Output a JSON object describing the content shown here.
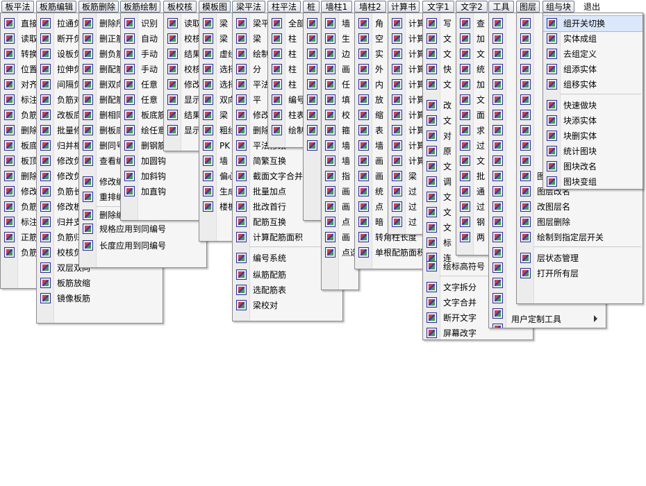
{
  "menubar": [
    "板平法",
    "板筋编辑",
    "板筋删除",
    "板筋绘制",
    "板校核",
    "模板图",
    "梁平法",
    "柱平法",
    "桩",
    "墙柱1",
    "墙柱2",
    "计算书",
    "文字1",
    "文字2",
    "工具",
    "图层",
    "组与块",
    "退出"
  ],
  "panels": {
    "p_banpingfa": [
      "直接",
      "读取",
      "转换",
      "位置",
      "对齐",
      "标注",
      "负筋",
      "删除",
      "板底",
      "板顶",
      "删除",
      "修改",
      "负筋",
      "标注",
      "正筋",
      "负筋"
    ],
    "p_banjin_edit": [
      "拉通负筋",
      "断开负筋",
      "设板负筋",
      "拉伸负筋",
      "间隔负筋",
      "负筋对齐",
      "改板底筋",
      "批量修改",
      "归并相同",
      "修改负筋",
      "修改负筋",
      "负筋长度",
      "修改板底",
      "归并支座",
      "负筋归并",
      "校核负筋长度",
      "双层双向",
      "板筋放缩",
      "镜像板筋"
    ],
    "p_banjin_del": [
      "删除所有",
      "删正筋",
      "删负筋",
      "删配筋",
      "删双向",
      "删配筋",
      "删相同",
      "删板底",
      "删同号",
      "查看编号",
      "修改编号",
      "重排编号",
      "删除编号",
      "规格应用到同编号",
      "长度应用到同编号"
    ],
    "p_banjin_draw": [
      "识别",
      "自动",
      "手动",
      "手动",
      "任意",
      "任意",
      "板底筋",
      "绘任意",
      "删钢筋钩子",
      "加圆钩",
      "加斜钩",
      "加直钩"
    ],
    "p_banjiaohe": [
      "读取",
      "校核",
      "结果",
      "校核",
      "修改",
      "显示",
      "结果",
      "显示"
    ],
    "p_mobantu": [
      "梁",
      "梁",
      "虚线",
      "选择",
      "选择",
      "双向",
      "梁",
      "粗线",
      "PK",
      "墙",
      "偏心",
      "生成",
      "楼板"
    ],
    "p_liangpingfa": [
      "梁平",
      "梁",
      "绘制",
      "分",
      "平法",
      "平",
      "修改",
      "删除",
      "平法修改",
      "简繁互换",
      "截面文字合并",
      "批量加点",
      "批改首行",
      "配筋互换",
      "计算配筋面积",
      "编号系统",
      "纵筋配筋",
      "选配筋表",
      "梁校对"
    ],
    "p_zhupingfa": [
      "全部",
      "柱",
      "柱",
      "柱",
      "柱",
      "编号",
      "柱表",
      "绘制"
    ],
    "p_zhuang": [
      "",
      "",
      "",
      "",
      "",
      "",
      "",
      "",
      ""
    ],
    "p_qiangzhu1": [
      "墙",
      "生",
      "边",
      "画",
      "任",
      "填",
      "校",
      "箍",
      "墙",
      "墙",
      "指",
      "画",
      "画",
      "点",
      "画",
      "点选画箍筋"
    ],
    "p_qiangzhu2": [
      "角",
      "空",
      "实",
      "外",
      "内",
      "放",
      "缩",
      "表",
      "墙",
      "画",
      "画",
      "统",
      "点",
      "暗",
      "转角柱长度",
      "单根配筋面积"
    ],
    "p_jisuanshu": [
      "计算",
      "计算",
      "计算",
      "计算",
      "计算",
      "计算",
      "计算",
      "计算",
      "计算",
      "计算",
      "梁",
      "过",
      "过",
      "过"
    ],
    "p_wenzi1": [
      "写",
      "文",
      "文",
      "快",
      "文",
      "改",
      "文",
      "对",
      "原",
      "文",
      "调",
      "文",
      "文",
      "文",
      "标",
      "连",
      "绘标高符号",
      "文字拆分",
      "文字合并",
      "断开文字",
      "屏幕改字"
    ],
    "p_wenzi2": [
      "查",
      "加",
      "文",
      "统",
      "加",
      "文",
      "面",
      "求",
      "过",
      "文",
      "批",
      "通",
      "过",
      "钢",
      "两"
    ],
    "p_gongju": [
      "",
      "",
      "",
      "",
      "",
      "",
      "",
      "",
      "",
      "",
      "",
      "",
      "",
      "",
      "",
      "",
      "",
      "",
      "",
      "",
      "",
      "用户定制工具"
    ],
    "p_tuceng": [
      "",
      "",
      "",
      "",
      "",
      "",
      "",
      "",
      "",
      "",
      "图层加前缀",
      "图层改名",
      "改图层名",
      "图层删除",
      "绘制到指定层开关",
      "层状态管理",
      "打开所有层"
    ],
    "p_zuyukuai": [
      "组开关切换",
      "实体成组",
      "去组定义",
      "组添实体",
      "组移实体",
      "快速做块",
      "块添实体",
      "块删实体",
      "统计图块",
      "图块改名",
      "图块变组"
    ]
  },
  "colors": {
    "menubar_bg": "#ffffff",
    "panel_bg": "#f5f5f5",
    "highlight": "#dbe7fa",
    "border": "#8a8a8a"
  }
}
